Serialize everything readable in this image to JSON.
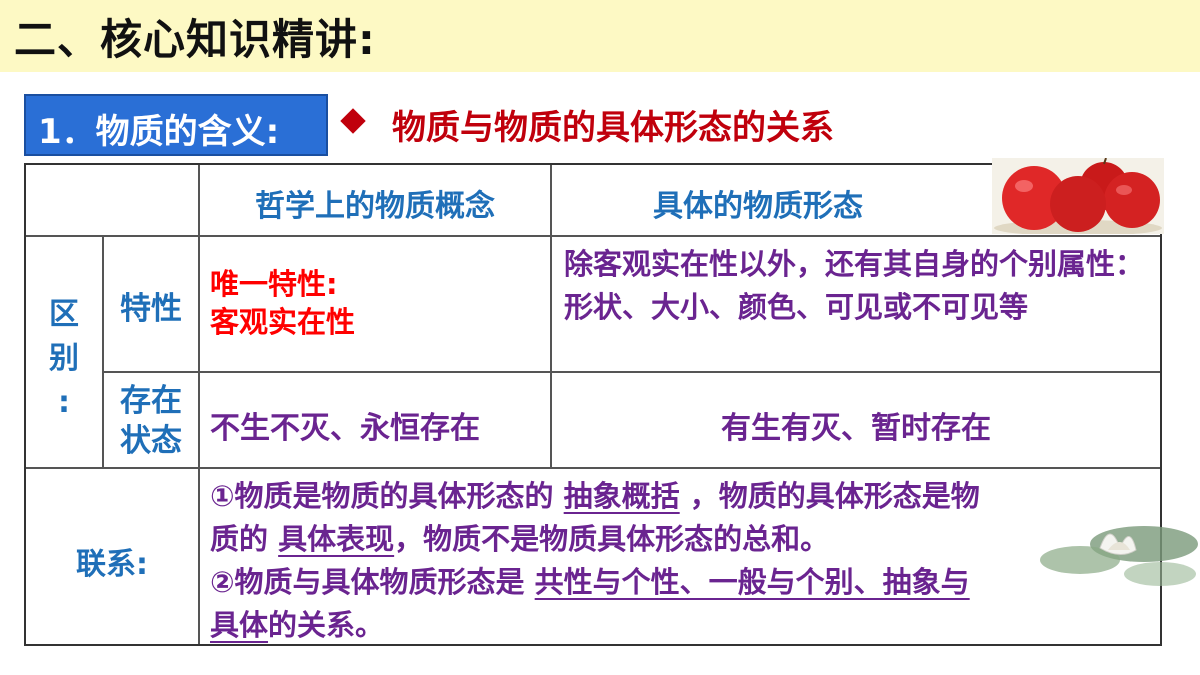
{
  "title": "二、核心知识精讲:",
  "section_label": "1．物质的含义:",
  "heading": "物质与物质的具体形态的关系",
  "table": {
    "col_headers": [
      "哲学上的物质概念",
      "具体的物质形态"
    ],
    "group_label": "区别:",
    "group_label_chars": [
      "区",
      "别",
      ":"
    ],
    "rows": [
      {
        "label": "特性",
        "philosophy": [
          "唯一特性:",
          "客观实在性"
        ],
        "concrete": "除客观实在性以外，还有其自身的个别属性：形状、大小、颜色、可见或不可见等"
      },
      {
        "label": "存在状态",
        "label_lines": [
          "存在",
          "状态"
        ],
        "philosophy": "不生不灭、永恒存在",
        "concrete": "有生有灭、暂时存在"
      }
    ],
    "link": {
      "label": "联系:",
      "l1_a": "①物质是物质的具体形态的",
      "l1_u": "抽象概括",
      "l1_b": "，物质的具体形态是物",
      "l2_a": "质的",
      "l2_u": "具体表现",
      "l2_b": "，物质不是物质具体形态的总和。",
      "l3_a": "②物质与具体物质形态是",
      "l3_u": "共性与个性、一般与个别、抽象与",
      "l4_u": "具体",
      "l4_b": "的关系。"
    }
  },
  "images": {
    "apples": "apples-image",
    "lotus": "lotus-image"
  },
  "colors": {
    "title_bg": "#fdf9c4",
    "section_bg": "#2a6fd6",
    "heading": "#c0000c",
    "blue_text": "#1f6fb8",
    "purple_text": "#6a2490",
    "red_text": "#ff0000"
  }
}
